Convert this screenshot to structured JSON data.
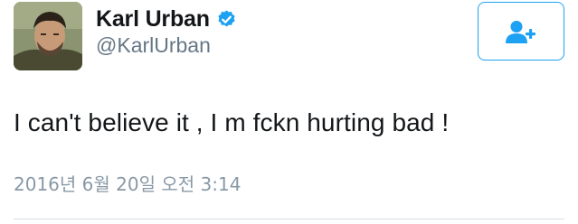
{
  "profile": {
    "display_name": "Karl Urban",
    "handle": "@KarlUrban",
    "verified": true,
    "avatar_icon": "profile-photo"
  },
  "follow_button": {
    "icon": "follow-user-plus-icon",
    "accent_color": "#1da1f2"
  },
  "tweet": {
    "text": "I can't believe it , I m fckn hurting bad !",
    "timestamp": "2016년 6월 20일 오전 3:14"
  },
  "colors": {
    "primary_text": "#14171a",
    "secondary_text": "#657786",
    "timestamp_text": "#8899a6",
    "verified_badge": "#1da1f2",
    "divider": "#d7dde2"
  }
}
